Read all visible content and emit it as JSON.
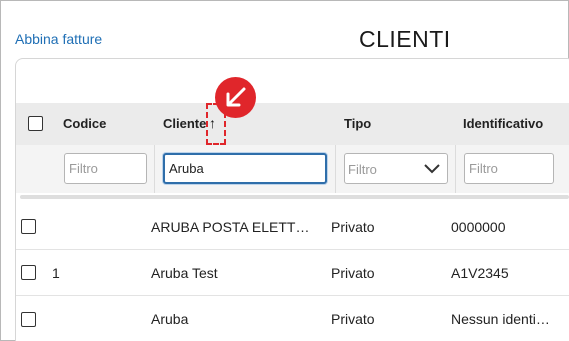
{
  "header": {
    "link_label": "Abbina fatture",
    "title": "CLIENTI"
  },
  "table": {
    "columns": [
      "Codice",
      "Cliente",
      "Tipo",
      "Identificativo"
    ],
    "sort": {
      "column": "Cliente",
      "direction": "ascending",
      "icon": "arrow-up-icon"
    },
    "filters": {
      "codice": {
        "value": "",
        "placeholder": "Filtro"
      },
      "cliente": {
        "value": "Aruba",
        "placeholder": "Filtro"
      },
      "tipo": {
        "value": "",
        "placeholder": "Filtro"
      },
      "identificativo": {
        "value": "",
        "placeholder": "Filtro"
      }
    },
    "rows": [
      {
        "codice": "",
        "cliente": "ARUBA POSTA ELETT…",
        "tipo": "Privato",
        "identificativo": "0000000"
      },
      {
        "codice": "1",
        "cliente": "Aruba Test",
        "tipo": "Privato",
        "identificativo": "A1V2345"
      },
      {
        "codice": "",
        "cliente": "Aruba",
        "tipo": "Privato",
        "identificativo": "Nessun identi…"
      }
    ]
  },
  "annotation": {
    "color": "#e0262b",
    "icon": "arrow-down-left-icon"
  }
}
